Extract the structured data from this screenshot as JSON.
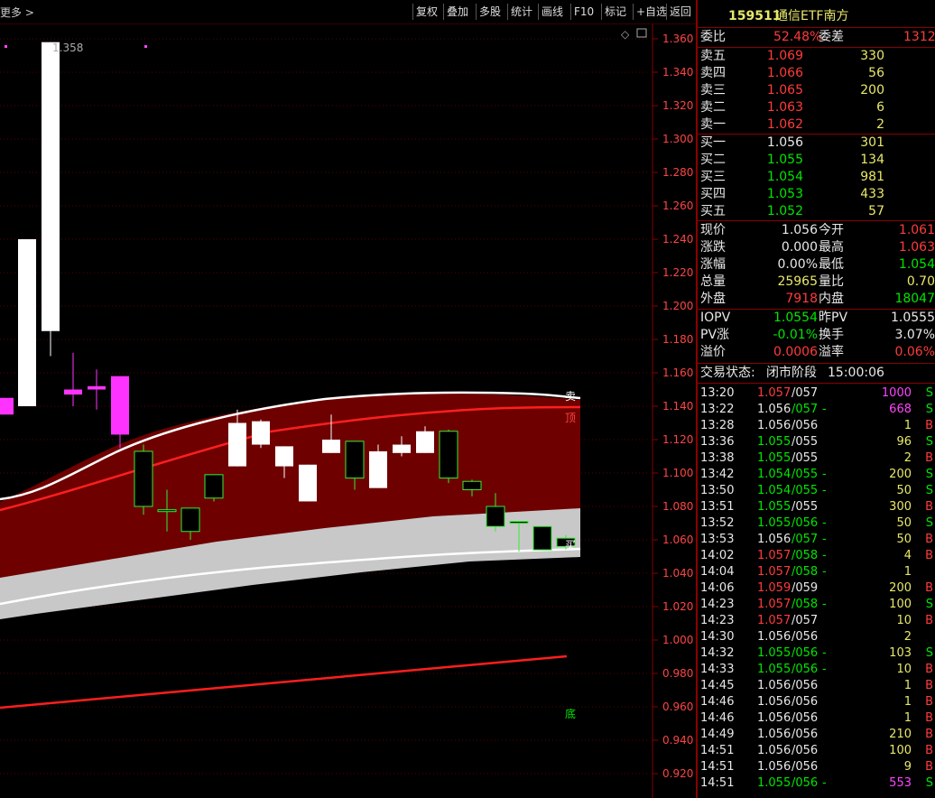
{
  "toolbar": {
    "left_label": "更多 >",
    "buttons": [
      "复权",
      "叠加",
      "多股",
      "统计",
      "画线",
      "F10",
      "标记",
      "+自选",
      "返回"
    ]
  },
  "chart": {
    "y_ticks": [
      "1.360",
      "1.340",
      "1.320",
      "1.300",
      "1.280",
      "1.260",
      "1.240",
      "1.220",
      "1.200",
      "1.180",
      "1.160",
      "1.140",
      "1.120",
      "1.100",
      "1.080",
      "1.060",
      "1.040",
      "1.020",
      "1.000",
      "0.980",
      "0.960",
      "0.940",
      "0.920"
    ],
    "max_label": "1.358",
    "signal_sell": "卖",
    "signal_top": "顶",
    "signal_buy": "买",
    "signal_bottom": "底"
  },
  "quote": {
    "title_code": "159511",
    "title_name": "通信ETF南方",
    "weibi_label": "委比",
    "weibi_value": "52.48%",
    "weicha_label": "委差",
    "weicha_value": "1312",
    "asks": [
      {
        "label": "卖五",
        "price": "1.069",
        "vol": "330"
      },
      {
        "label": "卖四",
        "price": "1.066",
        "vol": "56"
      },
      {
        "label": "卖三",
        "price": "1.065",
        "vol": "200"
      },
      {
        "label": "卖二",
        "price": "1.063",
        "vol": "6"
      },
      {
        "label": "卖一",
        "price": "1.062",
        "vol": "2"
      }
    ],
    "bids": [
      {
        "label": "买一",
        "price": "1.056",
        "vol": "301"
      },
      {
        "label": "买二",
        "price": "1.055",
        "vol": "134"
      },
      {
        "label": "买三",
        "price": "1.054",
        "vol": "981"
      },
      {
        "label": "买四",
        "price": "1.053",
        "vol": "433"
      },
      {
        "label": "买五",
        "price": "1.052",
        "vol": "57"
      }
    ],
    "stats": [
      {
        "l1": "现价",
        "v1": "1.056",
        "l2": "今开",
        "v2": "1.061"
      },
      {
        "l1": "涨跌",
        "v1": "0.000",
        "l2": "最高",
        "v2": "1.063"
      },
      {
        "l1": "涨幅",
        "v1": "0.00%",
        "l2": "最低",
        "v2": "1.054"
      },
      {
        "l1": "总量",
        "v1": "25965",
        "l2": "量比",
        "v2": "0.70"
      },
      {
        "l1": "外盘",
        "v1": "7918",
        "l2": "内盘",
        "v2": "18047"
      }
    ],
    "iopv": [
      {
        "l1": "IOPV",
        "v1": "1.0554",
        "l2": "昨PV",
        "v2": "1.0555"
      },
      {
        "l1": "PV涨",
        "v1": "-0.01%",
        "l2": "换手",
        "v2": "3.07%"
      },
      {
        "l1": "溢价",
        "v1": "0.0006",
        "l2": "溢率",
        "v2": "0.06%"
      }
    ],
    "status_label": "交易状态:",
    "status_value": "闭市阶段",
    "status_time": "15:00:06",
    "ticks": [
      {
        "t": "13:20",
        "p": "1.057",
        "r": "/057",
        "a": "",
        "v": "1000",
        "s": "S"
      },
      {
        "t": "13:22",
        "p": "1.056",
        "r": "/057",
        "a": "-",
        "v": "668",
        "s": "S"
      },
      {
        "t": "13:28",
        "p": "1.056",
        "r": "/056",
        "a": "",
        "v": "1",
        "s": "B"
      },
      {
        "t": "13:36",
        "p": "1.055",
        "r": "/055",
        "a": "",
        "v": "96",
        "s": "S"
      },
      {
        "t": "13:38",
        "p": "1.055",
        "r": "/055",
        "a": "",
        "v": "2",
        "s": "B"
      },
      {
        "t": "13:42",
        "p": "1.054",
        "r": "/055",
        "a": "-",
        "v": "200",
        "s": "S"
      },
      {
        "t": "13:50",
        "p": "1.054",
        "r": "/055",
        "a": "-",
        "v": "50",
        "s": "S"
      },
      {
        "t": "13:51",
        "p": "1.055",
        "r": "/055",
        "a": "",
        "v": "300",
        "s": "B"
      },
      {
        "t": "13:52",
        "p": "1.055",
        "r": "/056",
        "a": "-",
        "v": "50",
        "s": "S"
      },
      {
        "t": "13:53",
        "p": "1.056",
        "r": "/057",
        "a": "-",
        "v": "50",
        "s": "B"
      },
      {
        "t": "14:02",
        "p": "1.057",
        "r": "/058",
        "a": "-",
        "v": "4",
        "s": "B"
      },
      {
        "t": "14:04",
        "p": "1.057",
        "r": "/058",
        "a": "-",
        "v": "1",
        "s": ""
      },
      {
        "t": "14:06",
        "p": "1.059",
        "r": "/059",
        "a": "",
        "v": "200",
        "s": "B"
      },
      {
        "t": "14:23",
        "p": "1.057",
        "r": "/058",
        "a": "-",
        "v": "100",
        "s": "S"
      },
      {
        "t": "14:23",
        "p": "1.057",
        "r": "/057",
        "a": "",
        "v": "10",
        "s": "B"
      },
      {
        "t": "14:30",
        "p": "1.056",
        "r": "/056",
        "a": "",
        "v": "2",
        "s": ""
      },
      {
        "t": "14:32",
        "p": "1.055",
        "r": "/056",
        "a": "-",
        "v": "103",
        "s": "S"
      },
      {
        "t": "14:33",
        "p": "1.055",
        "r": "/056",
        "a": "-",
        "v": "10",
        "s": "B"
      },
      {
        "t": "14:45",
        "p": "1.056",
        "r": "/056",
        "a": "",
        "v": "1",
        "s": "B"
      },
      {
        "t": "14:46",
        "p": "1.056",
        "r": "/056",
        "a": "",
        "v": "1",
        "s": "B"
      },
      {
        "t": "14:46",
        "p": "1.056",
        "r": "/056",
        "a": "",
        "v": "1",
        "s": "B"
      },
      {
        "t": "14:49",
        "p": "1.056",
        "r": "/056",
        "a": "",
        "v": "210",
        "s": "B"
      },
      {
        "t": "14:51",
        "p": "1.056",
        "r": "/056",
        "a": "",
        "v": "100",
        "s": "B"
      },
      {
        "t": "14:51",
        "p": "1.056",
        "r": "/056",
        "a": "",
        "v": "9",
        "s": "B"
      },
      {
        "t": "14:51",
        "p": "1.055",
        "r": "/056",
        "a": "-",
        "v": "553",
        "s": "S"
      }
    ]
  },
  "colors": {
    "up": "#ff3b3b",
    "down": "#00e600",
    "flat": "#e8e8e8",
    "vol": "#e8e86a",
    "big": "#cc33cc"
  }
}
